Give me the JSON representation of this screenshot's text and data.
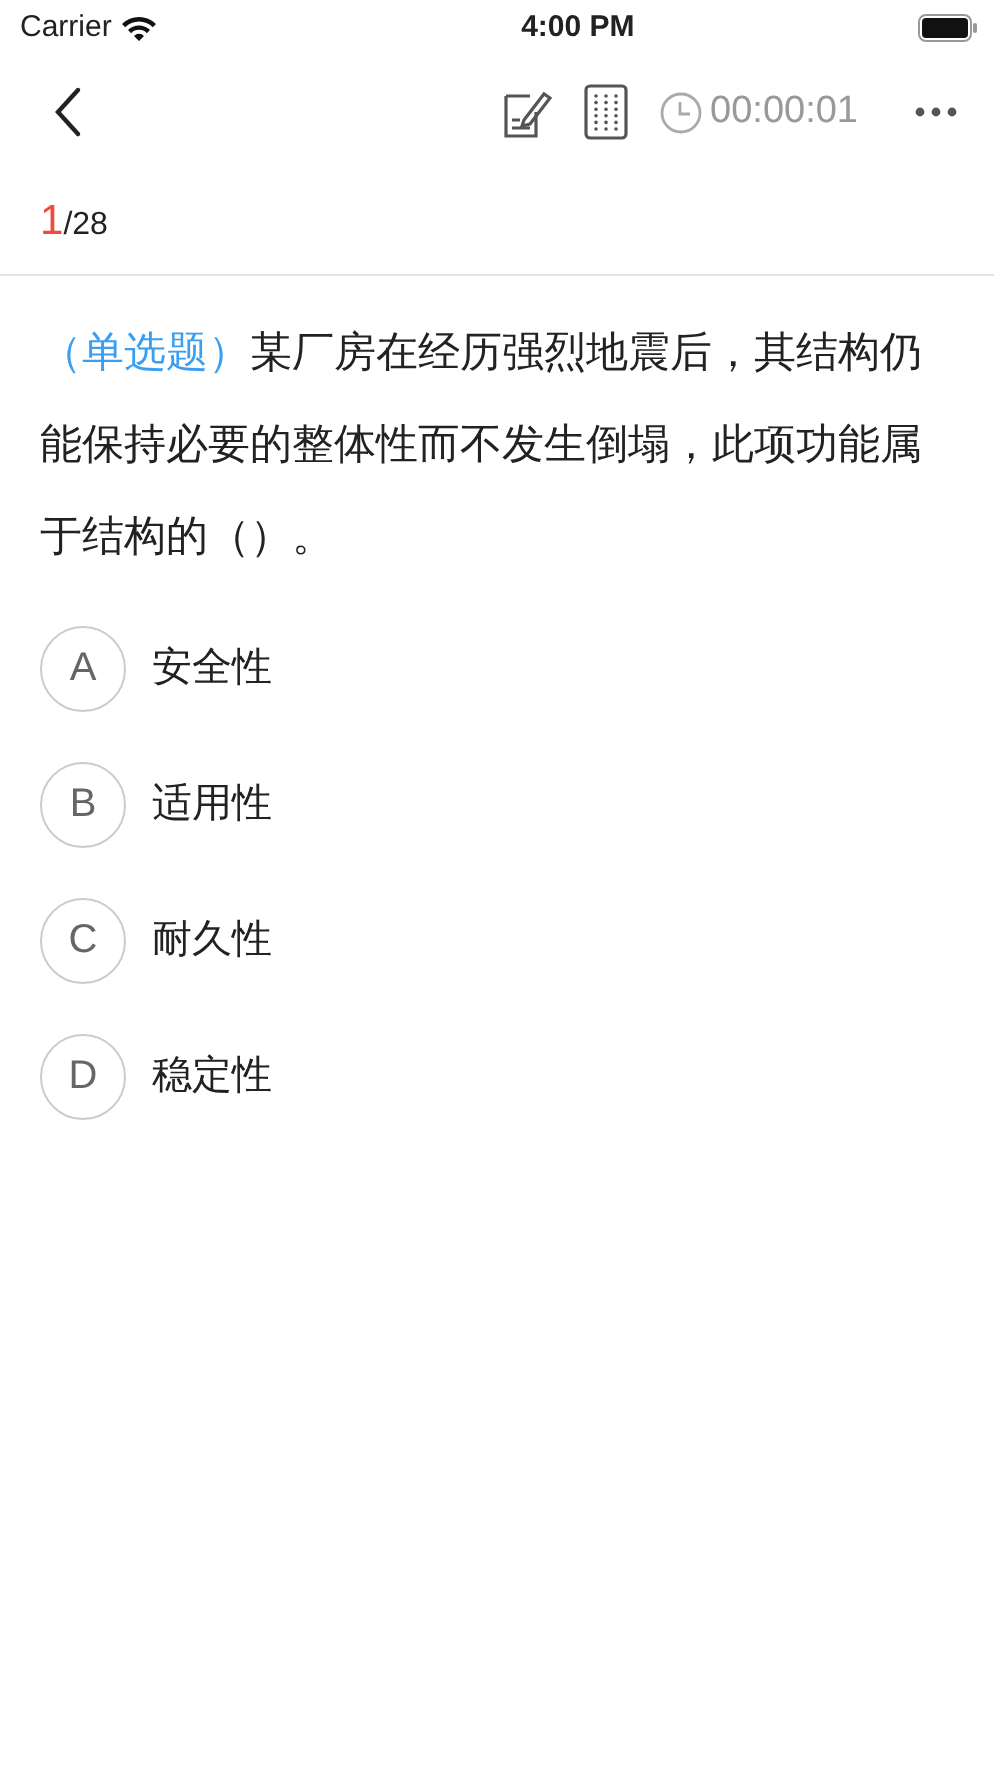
{
  "status_bar": {
    "carrier": "Carrier",
    "time": "4:00 PM"
  },
  "nav": {
    "timer": "00:00:01"
  },
  "progress": {
    "current": "1",
    "total": "/28"
  },
  "question": {
    "type_label": "（单选题）",
    "text": "某厂房在经历强烈地震后，其结构仍能保持必要的整体性而不发生倒塌，此项功能属于结构的（）。"
  },
  "options": [
    {
      "letter": "A",
      "text": "安全性",
      "selected": false
    },
    {
      "letter": "B",
      "text": "适用性",
      "selected": false
    },
    {
      "letter": "C",
      "text": "耐久性",
      "selected": false
    },
    {
      "letter": "D",
      "text": "稳定性",
      "selected": false
    }
  ]
}
